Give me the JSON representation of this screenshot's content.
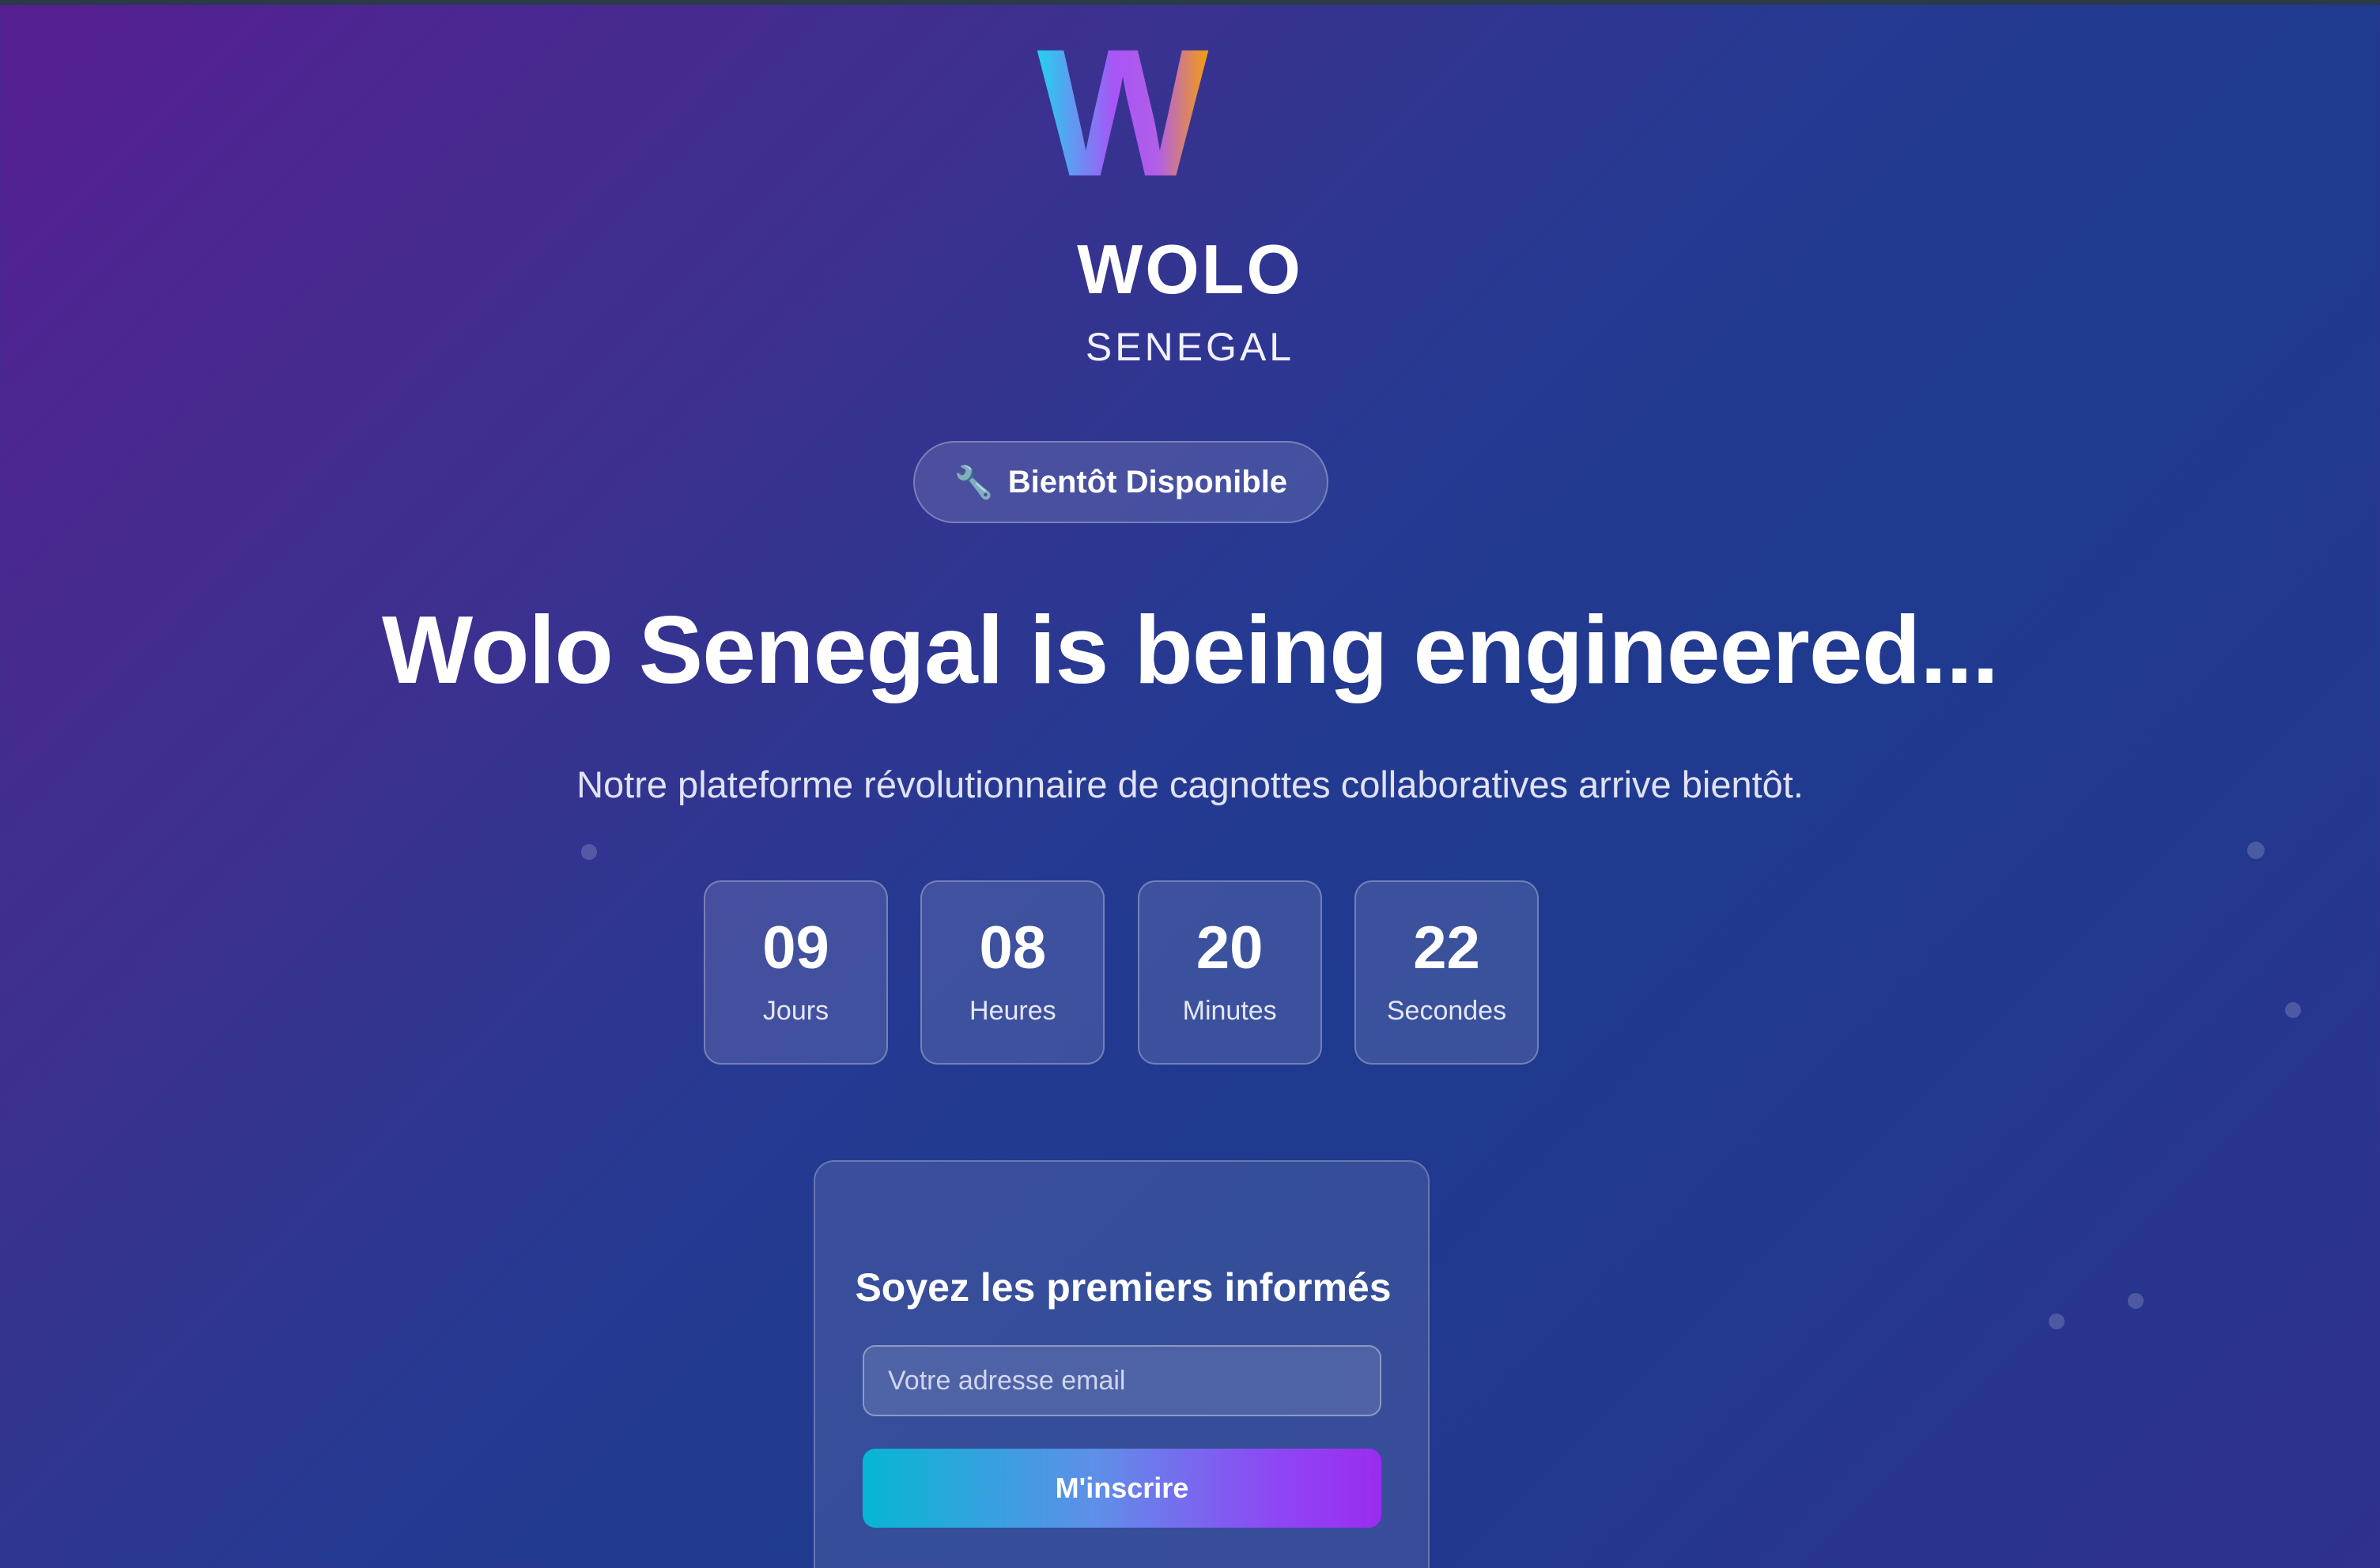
{
  "brand": {
    "logo_letter": "W",
    "name": "WOLO",
    "subtitle": "SENEGAL"
  },
  "status_pill": {
    "icon": "wrench-icon",
    "label": "Bientôt Disponible"
  },
  "hero": {
    "headline": "Wolo Senegal is being engineered...",
    "subtitle": "Notre plateforme révolutionnaire de cagnottes collaboratives arrive bientôt."
  },
  "countdown": {
    "items": [
      {
        "value": "09",
        "label": "Jours"
      },
      {
        "value": "08",
        "label": "Heures"
      },
      {
        "value": "20",
        "label": "Minutes"
      },
      {
        "value": "22",
        "label": "Secondes"
      }
    ]
  },
  "signup": {
    "title": "Soyez les premiers informés",
    "email_placeholder": "Votre adresse email",
    "button_label": "M'inscrire"
  },
  "colors": {
    "background_start": "#561f93",
    "background_end": "#1f3a8f",
    "button_gradient_start": "#06b6d4",
    "button_gradient_end": "#9b2cf0",
    "logo_gradient": [
      "#22d3ee",
      "#a855f7",
      "#f59e0b"
    ]
  }
}
